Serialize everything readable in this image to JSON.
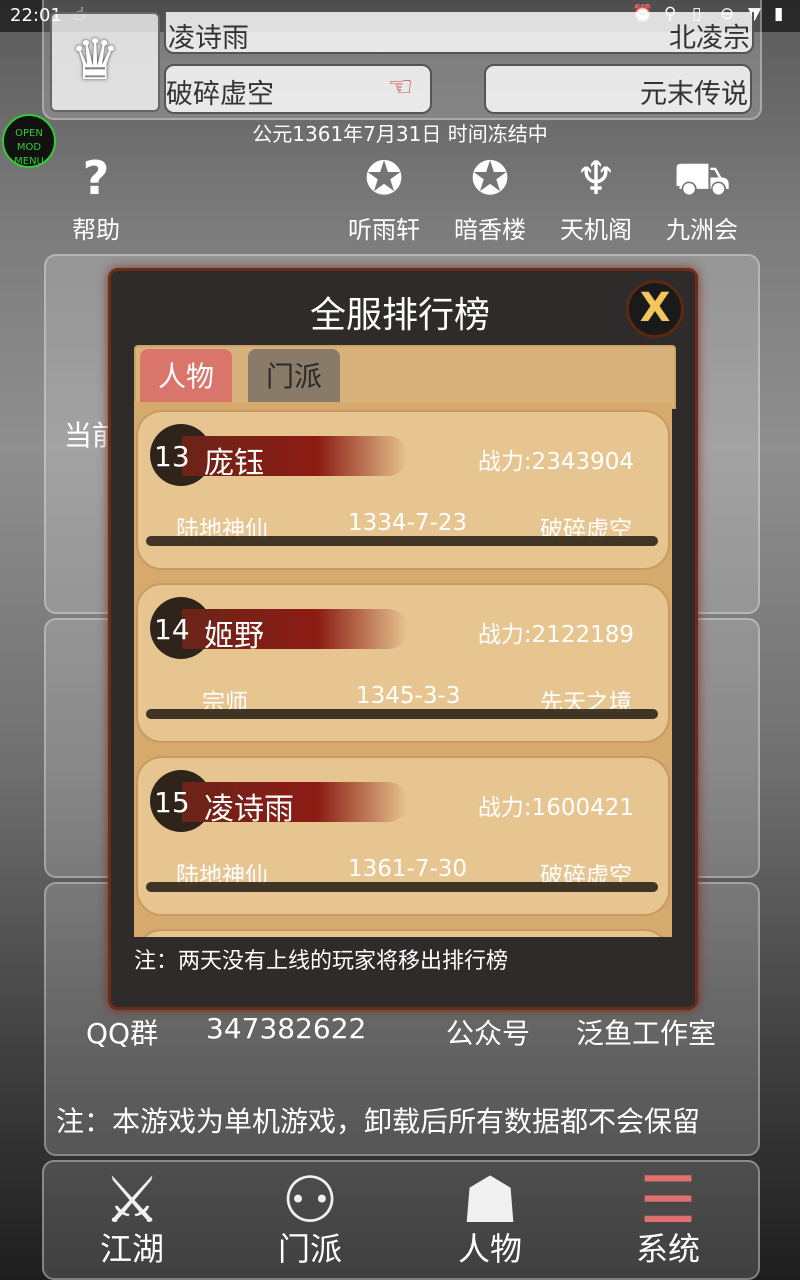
{
  "status_bar": {
    "time": "22:01"
  },
  "profile": {
    "name": "凌诗雨",
    "sect": "北凌宗",
    "realm": "破碎虚空",
    "title": "元末传说"
  },
  "mod_menu": {
    "line1": "OPEN",
    "line2": "MOD MENU"
  },
  "date_text": "公元1361年7月31日 时间冻结中",
  "top_nav": [
    {
      "label": "帮助",
      "icon": "question-icon"
    },
    {
      "label": "听雨轩",
      "icon": "badge-icon"
    },
    {
      "label": "暗香楼",
      "icon": "badge-icon"
    },
    {
      "label": "天机阁",
      "icon": "trophy-icon"
    },
    {
      "label": "九洲会",
      "icon": "cart-icon"
    }
  ],
  "background_text": {
    "current": "当前"
  },
  "modal": {
    "title": "全服排行榜",
    "close": "X",
    "tabs": [
      "人物",
      "门派"
    ],
    "entries": [
      {
        "rank": "13",
        "name": "庞钰",
        "power": "战力:2343904",
        "rank_title": "陆地神仙",
        "date": "1334-7-23",
        "realm": "破碎虚空"
      },
      {
        "rank": "14",
        "name": "姬野",
        "power": "战力:2122189",
        "rank_title": "宗师",
        "date": "1345-3-3",
        "realm": "先天之境"
      },
      {
        "rank": "15",
        "name": "凌诗雨",
        "power": "战力:1600421",
        "rank_title": "陆地神仙",
        "date": "1361-7-30",
        "realm": "破碎虚空"
      }
    ],
    "note": "注：两天没有上线的玩家将移出排行榜"
  },
  "contact": {
    "qq_label": "QQ群",
    "qq_number": "347382622",
    "wechat_label": "公众号",
    "wechat_name": "泛鱼工作室"
  },
  "footer_note": "注：本游戏为单机游戏，卸载后所有数据都不会保留",
  "bottom_nav": [
    {
      "label": "江湖",
      "icon": "crossed-swords-icon"
    },
    {
      "label": "门派",
      "icon": "group-icon"
    },
    {
      "label": "人物",
      "icon": "person-icon"
    },
    {
      "label": "系统",
      "icon": "menu-icon"
    }
  ],
  "colors": {
    "tab_active": "#d9756a",
    "tab_inactive": "#8a7b68",
    "modal_border": "#6b2c18",
    "card_bg": "#e7c590",
    "system_icon": "#e07070"
  }
}
